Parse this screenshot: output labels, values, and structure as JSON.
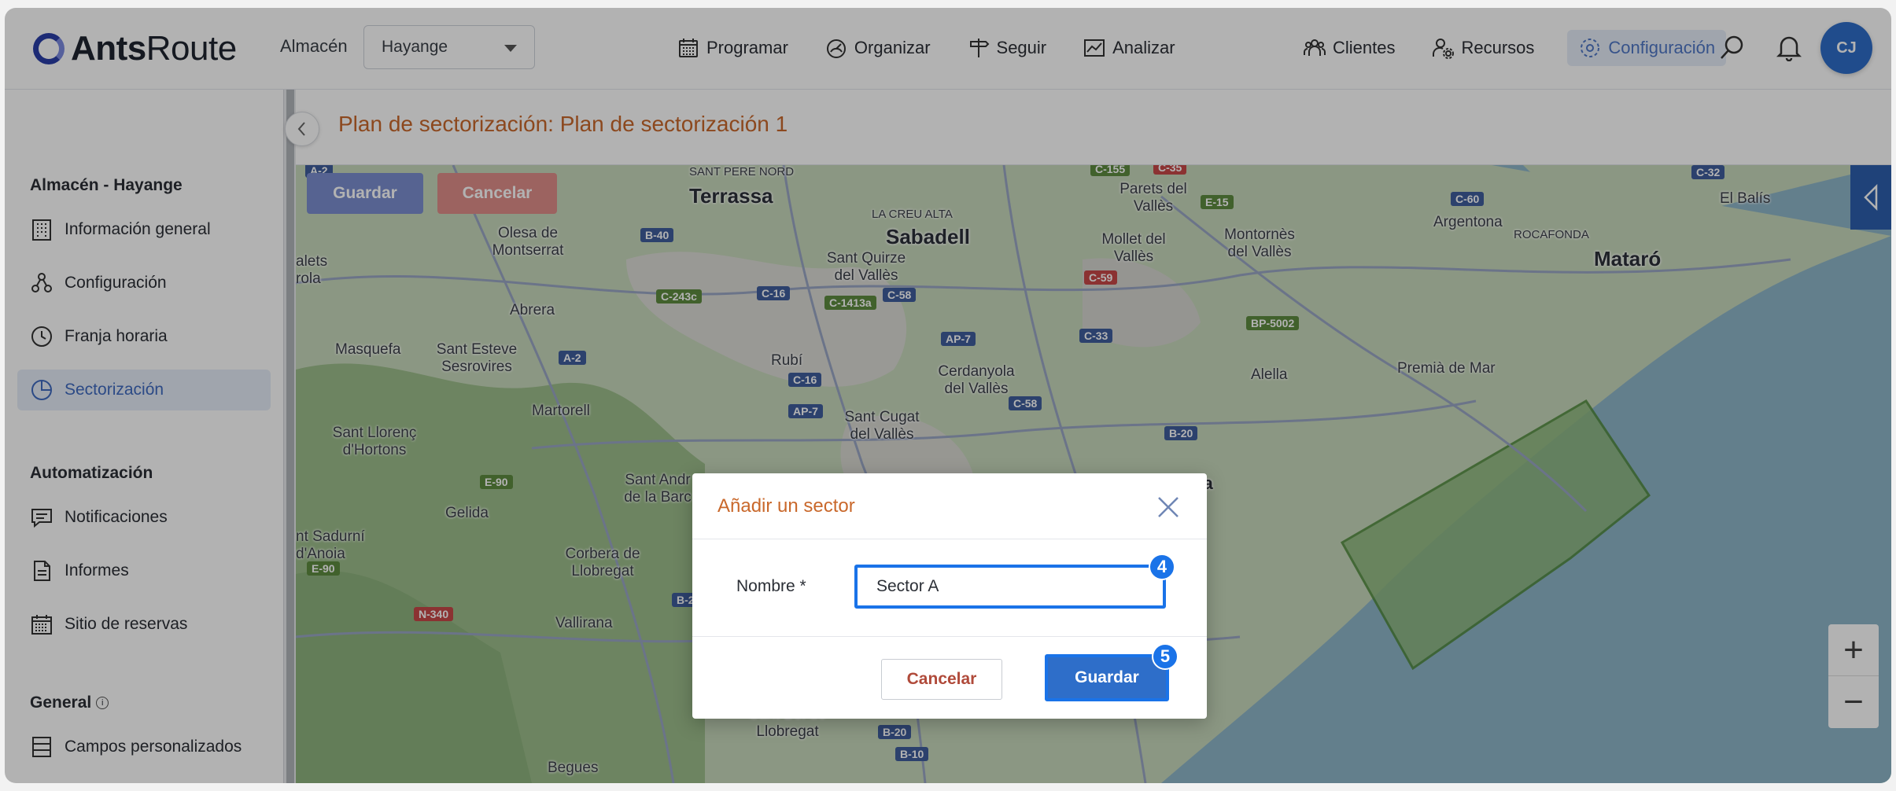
{
  "header": {
    "logo_bold": "Ants",
    "logo_light": "Route",
    "store_label": "Almacén",
    "store_value": "Hayange",
    "nav_center": [
      {
        "label": "Programar",
        "icon": "calendar-icon"
      },
      {
        "label": "Organizar",
        "icon": "gauge-icon"
      },
      {
        "label": "Seguir",
        "icon": "signpost-icon"
      },
      {
        "label": "Analizar",
        "icon": "chart-icon"
      }
    ],
    "nav_right": [
      {
        "label": "Clientes",
        "icon": "users-icon"
      },
      {
        "label": "Recursos",
        "icon": "user-gear-icon"
      },
      {
        "label": "Configuración",
        "icon": "gear-icon",
        "active": true
      }
    ],
    "avatar_initials": "CJ"
  },
  "sidebar": {
    "section1": "Almacén - Hayange",
    "section1_items": [
      {
        "label": "Información general",
        "icon": "building-icon"
      },
      {
        "label": "Configuración",
        "icon": "nodes-icon"
      },
      {
        "label": "Franja horaria",
        "icon": "clock-icon"
      },
      {
        "label": "Sectorización",
        "icon": "pie-icon",
        "active": true
      }
    ],
    "section2": "Automatización",
    "section2_items": [
      {
        "label": "Notificaciones",
        "icon": "message-icon"
      },
      {
        "label": "Informes",
        "icon": "document-icon"
      },
      {
        "label": "Sitio de reservas",
        "icon": "calendar-grid-icon"
      }
    ],
    "section3": "General",
    "section3_items": [
      {
        "label": "Campos personalizados",
        "icon": "list-icon"
      }
    ]
  },
  "main": {
    "title": "Plan de sectorización: Plan de sectorización 1",
    "map_save": "Guardar",
    "map_cancel": "Cancelar"
  },
  "map_labels": {
    "terrassa": "Terrassa",
    "sabadell": "Sabadell",
    "mataro": "Mataró",
    "la_creu_alta": "LA CREU ALTA",
    "parets": "Parets del Vallès",
    "el_balis": "El Balís",
    "argentona": "Argentona",
    "rocafonda": "ROCAFONDA",
    "olesa": "Olesa de Montserrat",
    "sant_quirze": "Sant Quirze del Vallès",
    "mollet": "Mollet del Vallès",
    "montornes": "Montornès del Vallès",
    "aletas": "alets rola",
    "abrera": "Abrera",
    "masquefa": "Masquefa",
    "sant_esteve": "Sant Esteve Sesrovires",
    "rubi": "Rubí",
    "cerdanyola": "Cerdanyola del Vallès",
    "alella": "Alella",
    "premia": "Premià de Mar",
    "martorell": "Martorell",
    "sant_cugat": "Sant Cugat del Vallès",
    "sant_llorenc": "Sant Llorenç d'Hortons",
    "sant_andreu": "Sant Andr de la Barc",
    "gelida": "Gelida",
    "sadurni": "nt Sadurní d'Anoia",
    "corbera": "Corbera de Llobregat",
    "vallirana": "Vallirana",
    "sant_boi": "Sant Boi de Llobregat",
    "begues": "Begues",
    "badalona_frag": "na",
    "sant_pere": "SANT PERE NORD"
  },
  "roads": [
    "C-155",
    "C-35",
    "E-15",
    "C-60",
    "C-32",
    "B-40",
    "C-243c",
    "C-16",
    "C-1413a",
    "C-58",
    "C-59",
    "AP-7",
    "C-33",
    "BP-5002",
    "A-2",
    "C-16",
    "AP-7",
    "C-58",
    "B-20",
    "E-90",
    "E-90",
    "N-340",
    "B-2",
    "B-20",
    "B-10",
    "A-2"
  ],
  "modal": {
    "title": "Añadir un sector",
    "field_label": "Nombre *",
    "field_value": "Sector A",
    "cancel": "Cancelar",
    "save": "Guardar",
    "badge_input": "4",
    "badge_save": "5"
  }
}
